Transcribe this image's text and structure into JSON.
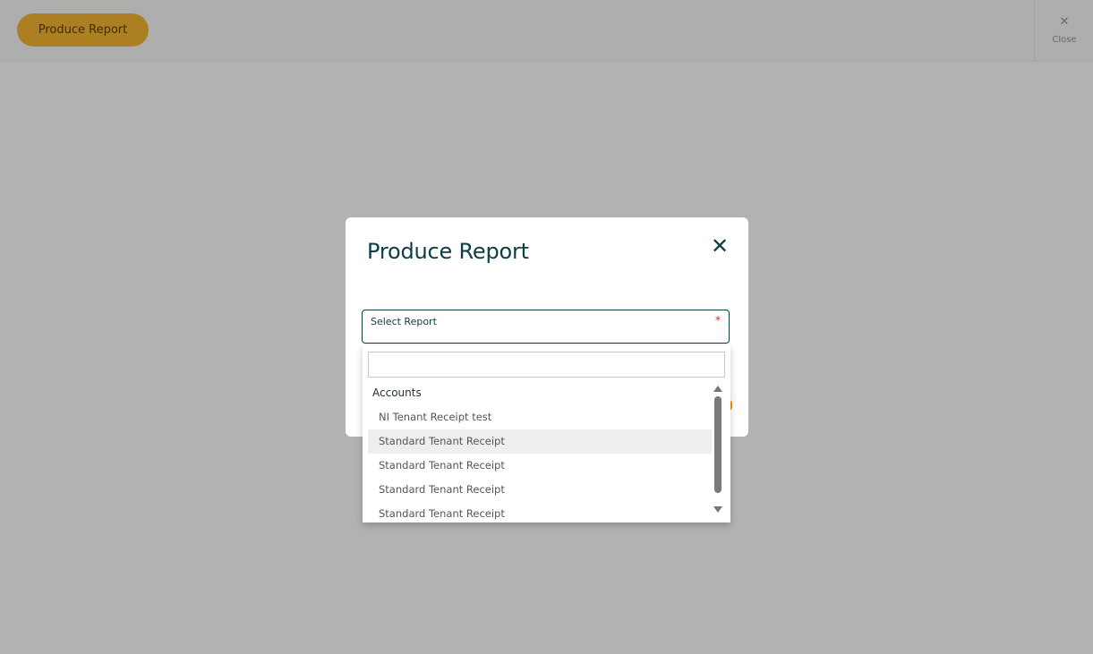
{
  "toolbar": {
    "produce_report_label": "Produce Report",
    "close_label": "Close",
    "close_glyph": "✕"
  },
  "modal": {
    "title": "Produce Report",
    "close_glyph": "✕",
    "select": {
      "label": "Select Report",
      "required_marker": "*"
    }
  },
  "dropdown": {
    "search_value": "",
    "group_label": "Accounts",
    "items": [
      "NI Tenant Receipt test",
      "Standard Tenant Receipt",
      "Standard Tenant Receipt",
      "Standard Tenant Receipt",
      "Standard Tenant Receipt"
    ]
  },
  "colors": {
    "accent": "#f7b733",
    "heading": "#0d3d45",
    "required": "#dd2222",
    "hover_row": "#eeeeee"
  }
}
